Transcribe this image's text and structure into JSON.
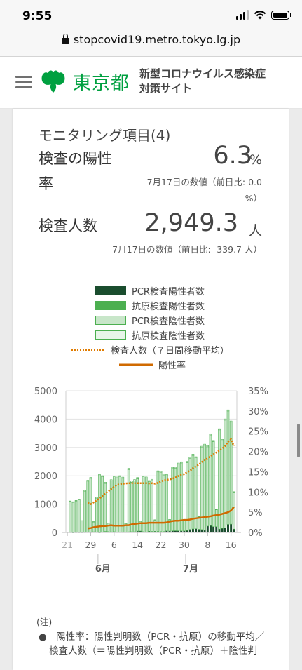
{
  "status_bar": {
    "time": "9:55"
  },
  "browser": {
    "url": "stopcovid19.metro.tokyo.lg.jp"
  },
  "header": {
    "logo_text": "東京都",
    "site_title_line1": "新型コロナウイルス感染症",
    "site_title_line2": "対策サイト"
  },
  "card": {
    "title": "モニタリング項目(4)",
    "metric1": {
      "label_line1": "検査の陽性",
      "label_line2": "率",
      "value": "6.3",
      "unit": "%",
      "sub_line1": "7月17日の数値（前日比: 0.0",
      "sub_line2": "%）"
    },
    "metric2": {
      "label": "検査人数",
      "value": "2,949.3",
      "unit": "人",
      "sub": "7月17日の数値（前日比: -339.7 人）"
    }
  },
  "legend": [
    {
      "label": "PCR検査陽性者数",
      "color": "#1a4d2e"
    },
    {
      "label": "抗原検査陽性者数",
      "color": "#4caf50"
    },
    {
      "label": "PCR検査陰性者数",
      "color": "#c8e6c9"
    },
    {
      "label": "抗原検査陰性者数",
      "color": "#e8f5e9"
    },
    {
      "label": "検査人数（７日間移動平均）",
      "color": "#e07b00"
    },
    {
      "label": "陽性率",
      "color": "#d06a00"
    }
  ],
  "colors": {
    "accent": "#00a040",
    "pcr_pos": "#1a4d2e",
    "ag_pos": "#4caf50",
    "pcr_neg": "#c8e6c9",
    "ag_neg": "#e8f5e9",
    "avg_line": "#e07b00",
    "rate_line": "#d06a00"
  },
  "chart_data": {
    "type": "bar",
    "ylim": [
      0,
      5000
    ],
    "y2lim": [
      0,
      35
    ],
    "y_ticks": [
      "0",
      "1000",
      "2000",
      "3000",
      "4000",
      "5000"
    ],
    "y2_ticks": [
      "0%",
      "5%",
      "10%",
      "15%",
      "20%",
      "25%",
      "30%",
      "35%"
    ],
    "x_ticks": [
      "21",
      "29",
      "6",
      "14",
      "22",
      "30",
      "8",
      "16"
    ],
    "month_labels": [
      "6月",
      "7月"
    ],
    "x": [
      "5/21",
      "5/22",
      "5/23",
      "5/24",
      "5/25",
      "5/26",
      "5/27",
      "5/28",
      "5/29",
      "5/30",
      "5/31",
      "6/1",
      "6/2",
      "6/3",
      "6/4",
      "6/5",
      "6/6",
      "6/7",
      "6/8",
      "6/9",
      "6/10",
      "6/11",
      "6/12",
      "6/13",
      "6/14",
      "6/15",
      "6/16",
      "6/17",
      "6/18",
      "6/19",
      "6/20",
      "6/21",
      "6/22",
      "6/23",
      "6/24",
      "6/25",
      "6/26",
      "6/27",
      "6/28",
      "6/29",
      "6/30",
      "7/1",
      "7/2",
      "7/3",
      "7/4",
      "7/5",
      "7/6",
      "7/7",
      "7/8",
      "7/9",
      "7/10",
      "7/11",
      "7/12",
      "7/13",
      "7/14",
      "7/15",
      "7/16",
      "7/17"
    ],
    "series": [
      {
        "name": "PCR検査陽性者数",
        "values": [
          0,
          11,
          4,
          10,
          9,
          8,
          11,
          12,
          11,
          22,
          14,
          5,
          13,
          34,
          28,
          20,
          26,
          14,
          13,
          12,
          18,
          22,
          25,
          24,
          47,
          48,
          27,
          16,
          41,
          35,
          39,
          35,
          29,
          31,
          55,
          48,
          57,
          60,
          58,
          54,
          54,
          67,
          107,
          124,
          131,
          111,
          102,
          75,
          224,
          243,
          206,
          206,
          119,
          143,
          165,
          286,
          293,
          119
        ]
      },
      {
        "name": "抗原検査陽性者数",
        "values": [
          0,
          0,
          0,
          0,
          0,
          0,
          0,
          0,
          0,
          0,
          0,
          0,
          0,
          0,
          0,
          0,
          0,
          0,
          0,
          0,
          0,
          0,
          0,
          0,
          0,
          0,
          0,
          0,
          0,
          0,
          0,
          0,
          0,
          0,
          0,
          0,
          0,
          0,
          0,
          0,
          0,
          0,
          0,
          0,
          0,
          0,
          0,
          0,
          0,
          0,
          0,
          0,
          0,
          0,
          0,
          0,
          0,
          0
        ]
      },
      {
        "name": "PCR検査陰性者数",
        "values": [
          0,
          1080,
          1060,
          1100,
          1150,
          400,
          1450,
          1800,
          1900,
          350,
          1200,
          2000,
          1950,
          1700,
          300,
          1800,
          1900,
          1900,
          1950,
          1900,
          300,
          2200,
          1750,
          1800,
          1850,
          350,
          1900,
          1900,
          1750,
          1800,
          400,
          2100,
          2100,
          2000,
          1950,
          400,
          2200,
          2200,
          2350,
          2400,
          400,
          2400,
          2500,
          2600,
          2500,
          450,
          2900,
          3000,
          2800,
          3200,
          3000,
          600,
          3500,
          3100,
          3800,
          4000,
          3600,
          1300
        ]
      },
      {
        "name": "抗原検査陰性者数",
        "values": [
          0,
          20,
          20,
          20,
          20,
          10,
          30,
          30,
          30,
          10,
          40,
          40,
          40,
          40,
          10,
          40,
          40,
          40,
          40,
          40,
          10,
          40,
          40,
          40,
          40,
          10,
          40,
          40,
          40,
          40,
          10,
          40,
          40,
          40,
          40,
          10,
          40,
          40,
          40,
          40,
          10,
          40,
          40,
          40,
          40,
          10,
          40,
          40,
          40,
          40,
          40,
          10,
          40,
          40,
          40,
          40,
          40,
          20
        ]
      },
      {
        "name": "検査人数（７日間移動平均）",
        "values": [
          null,
          null,
          null,
          null,
          null,
          null,
          null,
          1040,
          1000,
          1060,
          1130,
          1200,
          1290,
          1380,
          1450,
          1530,
          1610,
          1680,
          1700,
          1720,
          1730,
          1740,
          1740,
          1740,
          1740,
          1740,
          1740,
          1740,
          1730,
          1740,
          1720,
          1750,
          1800,
          1840,
          1860,
          1870,
          1900,
          1940,
          1990,
          2040,
          2060,
          2130,
          2180,
          2270,
          2330,
          2400,
          2480,
          2570,
          2620,
          2690,
          2760,
          2820,
          2890,
          2960,
          3050,
          3200,
          3290,
          3050
        ]
      },
      {
        "name": "陽性率",
        "values": [
          null,
          null,
          null,
          null,
          null,
          null,
          null,
          1.0,
          1.1,
          1.3,
          1.4,
          1.5,
          1.6,
          1.6,
          1.7,
          1.8,
          1.7,
          1.7,
          1.7,
          1.7,
          1.8,
          1.8,
          2.0,
          2.1,
          2.2,
          2.3,
          2.3,
          2.3,
          2.4,
          2.4,
          2.4,
          2.4,
          2.4,
          2.4,
          2.5,
          2.7,
          2.8,
          2.9,
          2.9,
          3.0,
          3.1,
          3.1,
          3.2,
          3.4,
          3.5,
          3.6,
          3.7,
          3.8,
          3.9,
          4.0,
          4.2,
          4.3,
          4.4,
          4.6,
          4.8,
          5.0,
          5.4,
          6.3
        ]
      }
    ]
  },
  "notes": {
    "head": "(注)",
    "line1": "●　陽性率：陽性判明数（PCR・抗原）の移動平均／",
    "line2": "検査人数（＝陽性判明数（PCR・抗原）＋陰性判"
  }
}
